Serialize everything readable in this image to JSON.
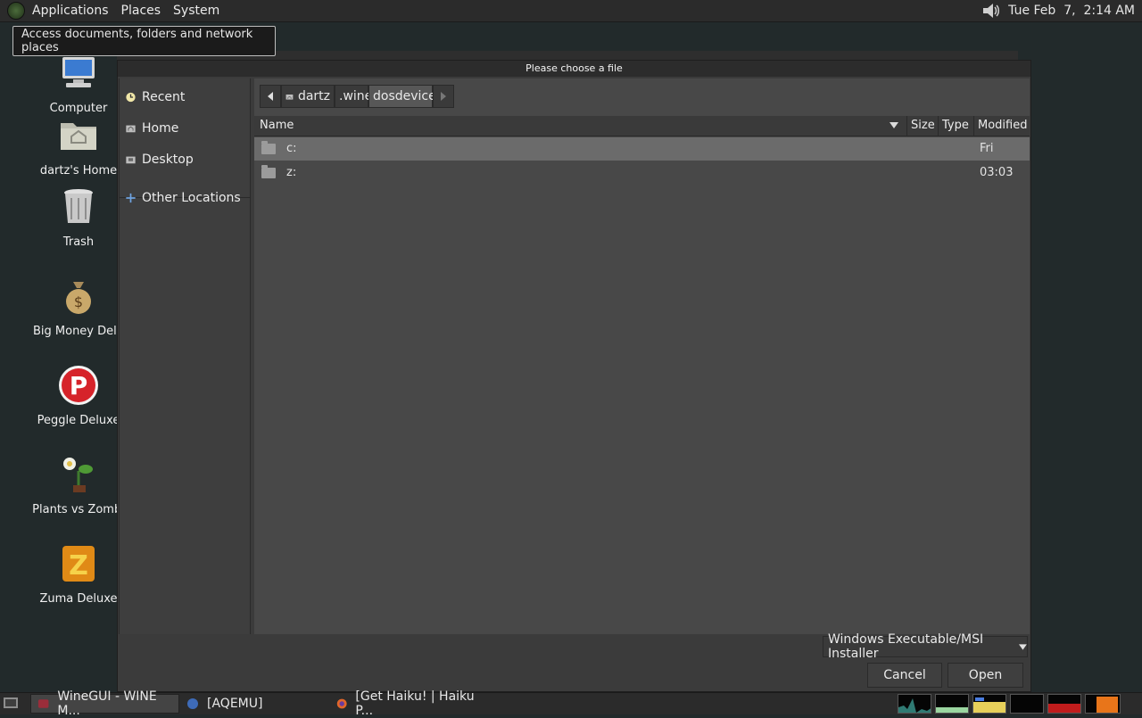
{
  "top_panel": {
    "menus": [
      "Applications",
      "Places",
      "System"
    ],
    "clock": "Tue Feb  7,  2:14 AM"
  },
  "tooltip": "Access documents, folders and network places",
  "desktop_icons": [
    {
      "label": "Computer"
    },
    {
      "label": "dartz's Home"
    },
    {
      "label": "Trash"
    },
    {
      "label": "Big Money Delu"
    },
    {
      "label": "Peggle Deluxe"
    },
    {
      "label": "Plants vs Zombi"
    },
    {
      "label": "Zuma Deluxe"
    }
  ],
  "dialog": {
    "title": "Please choose a file",
    "sidebar": {
      "items": [
        "Recent",
        "Home",
        "Desktop"
      ],
      "other": "Other Locations"
    },
    "path": [
      "dartz",
      ".wine",
      "dosdevices"
    ],
    "columns": [
      "Name",
      "Size",
      "Type",
      "Modified"
    ],
    "rows": [
      {
        "name": "c:",
        "modified": "Fri"
      },
      {
        "name": "z:",
        "modified": "03:03"
      }
    ],
    "filter": "Windows Executable/MSI Installer",
    "cancel": "Cancel",
    "open": "Open"
  },
  "taskbar": {
    "tasks": [
      "WineGUI - WINE M...",
      "[AQEMU]",
      "[Get Haiku! | Haiku P..."
    ]
  },
  "colors": {
    "selected_row": "#6b6b6b",
    "dialog_bg": "#3b3b3b",
    "desktop_bg": "#222a2b"
  }
}
